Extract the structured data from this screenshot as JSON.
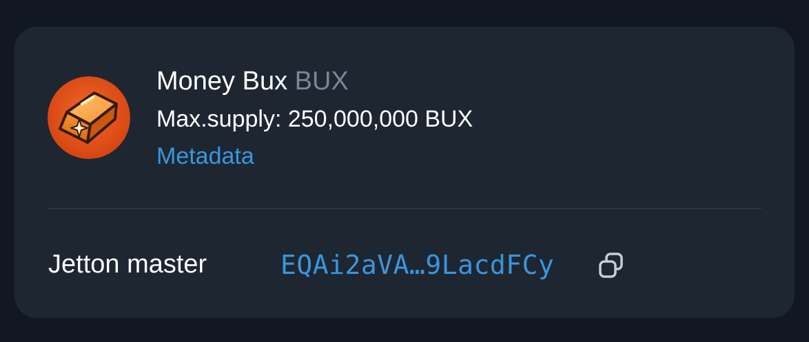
{
  "token": {
    "name": "Money Bux",
    "symbol": "BUX",
    "supply_label": "Max.supply: 250,000,000 BUX",
    "metadata_link": "Metadata",
    "icon": "gold-bar-icon"
  },
  "details": {
    "jetton_master_label": "Jetton master",
    "jetton_master_address": "EQAi2aVA…9LacdFCy",
    "copy_icon": "copy-icon"
  },
  "colors": {
    "background": "#121822",
    "card": "#1e2632",
    "text": "#ffffff",
    "muted": "#7b8594",
    "link": "#3a96dc",
    "icon_orange": "#e8521a"
  }
}
